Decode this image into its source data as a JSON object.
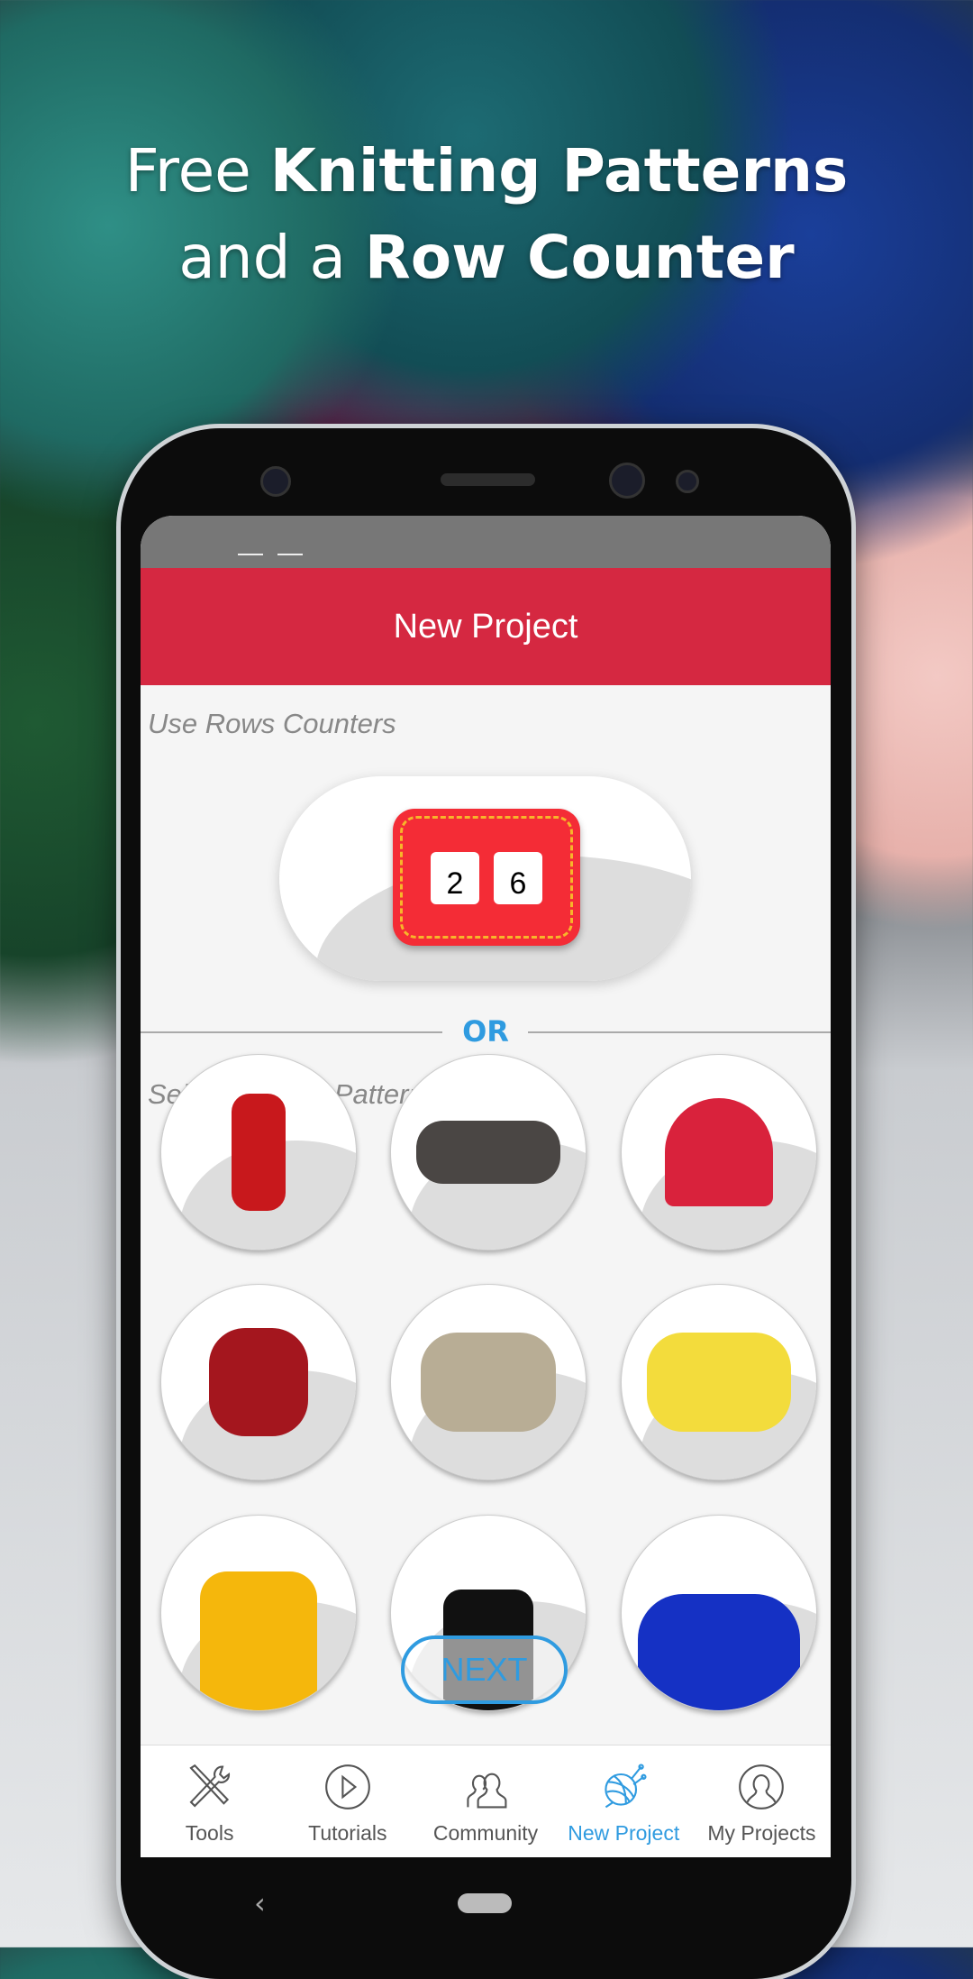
{
  "promo": {
    "line1_pre": "Free ",
    "line1_bold": "Knitting Patterns",
    "line2_pre": "and a ",
    "line2_bold": "Row Counter"
  },
  "header": {
    "title": "New Project"
  },
  "rows_counter": {
    "label": "Use Rows Counters",
    "digits": [
      "2",
      "6"
    ]
  },
  "divider": {
    "label": "OR"
  },
  "patterns": {
    "label": "Select Knitting Pattern",
    "items": [
      "scarf",
      "headband",
      "beanie",
      "mittens",
      "neck-warmer",
      "basket",
      "yellow-sweater",
      "dog-sweater",
      "blue-sweater"
    ]
  },
  "next_button": {
    "label": "NEXT"
  },
  "nav": {
    "items": [
      {
        "label": "Tools",
        "icon": "tools-icon"
      },
      {
        "label": "Tutorials",
        "icon": "play-circle-icon"
      },
      {
        "label": "Community",
        "icon": "community-icon"
      },
      {
        "label": "New Project",
        "icon": "yarn-ball-icon",
        "active": true
      },
      {
        "label": "My Projects",
        "icon": "user-circle-icon"
      }
    ]
  },
  "colors": {
    "header": "#d52841",
    "accent": "#2f9be0",
    "counter": "#f42c36"
  }
}
